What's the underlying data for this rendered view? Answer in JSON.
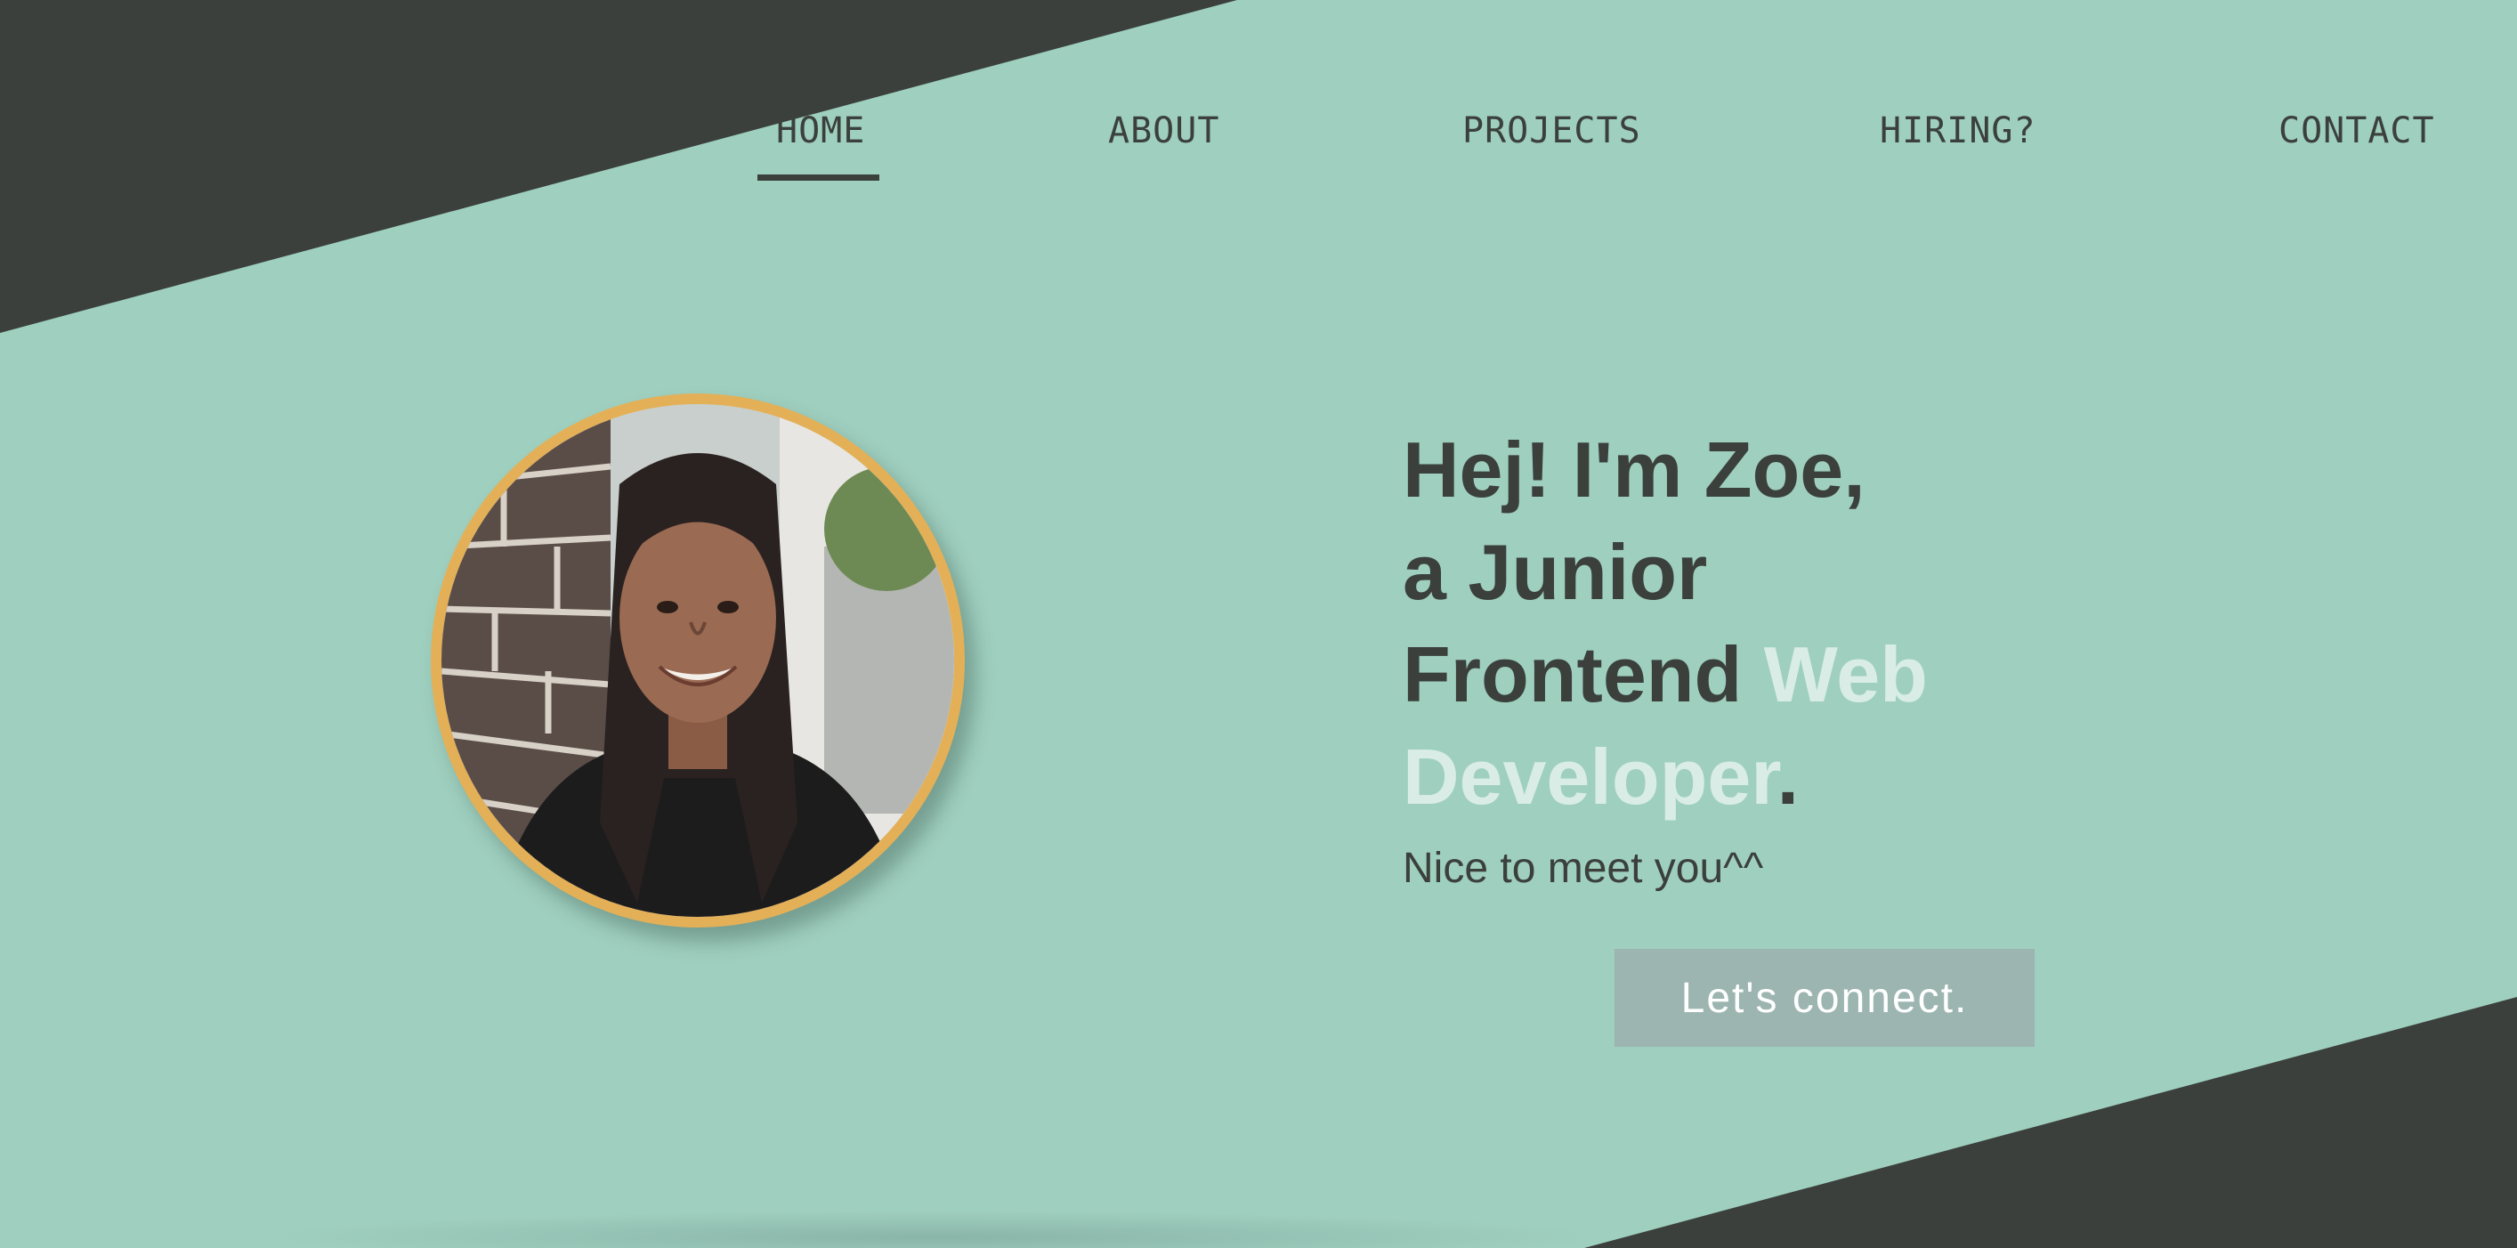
{
  "nav": {
    "items": [
      {
        "label": "HOME",
        "active": true
      },
      {
        "label": "ABOUT"
      },
      {
        "label": "PROJECTS"
      },
      {
        "label": "HIRING?"
      },
      {
        "label": "CONTACT"
      }
    ]
  },
  "hero": {
    "headline_line1": "Hej! I'm Zoe,",
    "headline_line2": "a Junior",
    "headline_line3": "Frontend ",
    "headline_accent1": "Web",
    "headline_accent2": "Developer",
    "headline_period": ".",
    "subtitle": "Nice to meet you^^",
    "cta_label": "Let's connect."
  },
  "colors": {
    "background": "#9fcfbf",
    "dark": "#3b403d",
    "accent_text": "#d9ede6",
    "avatar_ring": "#e4b057",
    "cta_bg": "#9cb5b0"
  },
  "icons": {
    "avatar": "profile-photo"
  }
}
